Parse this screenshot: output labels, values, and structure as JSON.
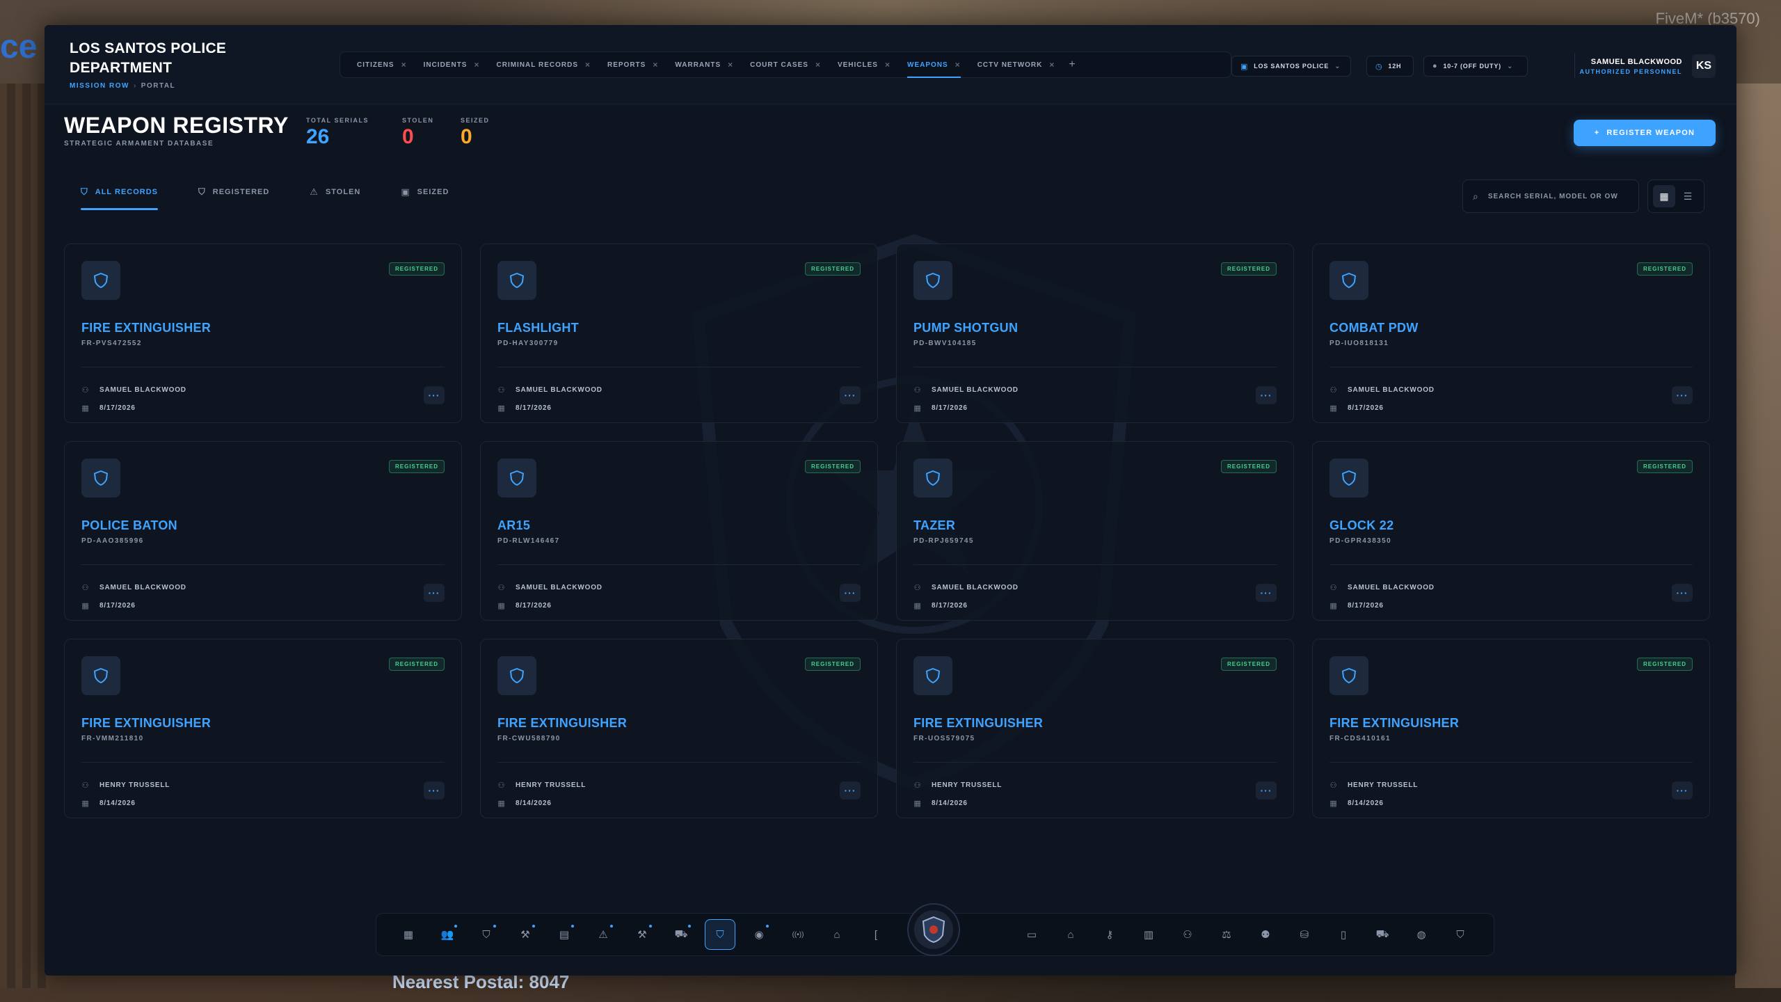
{
  "game": {
    "left_sign": "ce S",
    "fivem_label": "_FiveM* (b3570)",
    "postal_label": "Nearest Postal: 8047"
  },
  "header": {
    "dept_name": "LOS SANTOS POLICE DEPARTMENT",
    "location": "MISSION ROW",
    "portal": "PORTAL",
    "tabs": [
      {
        "label": "CITIZENS",
        "active": false
      },
      {
        "label": "INCIDENTS",
        "active": false
      },
      {
        "label": "CRIMINAL RECORDS",
        "active": false
      },
      {
        "label": "REPORTS",
        "active": false
      },
      {
        "label": "WARRANTS",
        "active": false
      },
      {
        "label": "COURT CASES",
        "active": false
      },
      {
        "label": "VEHICLES",
        "active": false
      },
      {
        "label": "WEAPONS",
        "active": true
      },
      {
        "label": "CCTV NETWORK",
        "active": false
      }
    ],
    "tab_close": "×",
    "tab_add": "+",
    "agency_select": "LOS SANTOS POLICE",
    "clock_format": "12H",
    "duty_status": "10-7 (OFF DUTY)",
    "user_name": "SAMUEL BLACKWOOD",
    "user_role": "AUTHORIZED PERSONNEL",
    "user_initials": "KS"
  },
  "page": {
    "title": "WEAPON REGISTRY",
    "subtitle": "STRATEGIC ARMAMENT DATABASE",
    "stats": [
      {
        "label": "TOTAL SERIALS",
        "value": "26",
        "color": "#3fa4ff"
      },
      {
        "label": "STOLEN",
        "value": "0",
        "color": "#ff4d4f"
      },
      {
        "label": "SEIZED",
        "value": "0",
        "color": "#ffa726"
      }
    ],
    "register_button": "REGISTER WEAPON",
    "filters": [
      {
        "label": "ALL RECORDS",
        "icon": "shield-icon",
        "active": true
      },
      {
        "label": "REGISTERED",
        "icon": "shield-check-icon",
        "active": false
      },
      {
        "label": "STOLEN",
        "icon": "warning-icon",
        "active": false
      },
      {
        "label": "SEIZED",
        "icon": "lock-icon",
        "active": false
      }
    ],
    "search_placeholder": "SEARCH SERIAL, MODEL OR OW"
  },
  "weapons": [
    {
      "name": "FIRE EXTINGUISHER",
      "serial": "FR-PVS472552",
      "owner": "SAMUEL BLACKWOOD",
      "date": "8/17/2026",
      "status": "REGISTERED"
    },
    {
      "name": "FLASHLIGHT",
      "serial": "PD-HAY300779",
      "owner": "SAMUEL BLACKWOOD",
      "date": "8/17/2026",
      "status": "REGISTERED"
    },
    {
      "name": "PUMP SHOTGUN",
      "serial": "PD-BWV104185",
      "owner": "SAMUEL BLACKWOOD",
      "date": "8/17/2026",
      "status": "REGISTERED"
    },
    {
      "name": "COMBAT PDW",
      "serial": "PD-IUO818131",
      "owner": "SAMUEL BLACKWOOD",
      "date": "8/17/2026",
      "status": "REGISTERED"
    },
    {
      "name": "POLICE BATON",
      "serial": "PD-AAO385996",
      "owner": "SAMUEL BLACKWOOD",
      "date": "8/17/2026",
      "status": "REGISTERED"
    },
    {
      "name": "AR15",
      "serial": "PD-RLW146467",
      "owner": "SAMUEL BLACKWOOD",
      "date": "8/17/2026",
      "status": "REGISTERED"
    },
    {
      "name": "TAZER",
      "serial": "PD-RPJ659745",
      "owner": "SAMUEL BLACKWOOD",
      "date": "8/17/2026",
      "status": "REGISTERED"
    },
    {
      "name": "GLOCK 22",
      "serial": "PD-GPR438350",
      "owner": "SAMUEL BLACKWOOD",
      "date": "8/17/2026",
      "status": "REGISTERED"
    },
    {
      "name": "FIRE EXTINGUISHER",
      "serial": "FR-VMM211810",
      "owner": "HENRY TRUSSELL",
      "date": "8/14/2026",
      "status": "REGISTERED"
    },
    {
      "name": "FIRE EXTINGUISHER",
      "serial": "FR-CWU588790",
      "owner": "HENRY TRUSSELL",
      "date": "8/14/2026",
      "status": "REGISTERED"
    },
    {
      "name": "FIRE EXTINGUISHER",
      "serial": "FR-UOS579075",
      "owner": "HENRY TRUSSELL",
      "date": "8/14/2026",
      "status": "REGISTERED"
    },
    {
      "name": "FIRE EXTINGUISHER",
      "serial": "FR-CDS410161",
      "owner": "HENRY TRUSSELL",
      "date": "8/14/2026",
      "status": "REGISTERED"
    }
  ],
  "more_label": "···",
  "dock": {
    "left": [
      {
        "icon": "dashboard-icon",
        "glyph": "▦",
        "dot": false
      },
      {
        "icon": "citizens-icon",
        "glyph": "👥",
        "dot": true
      },
      {
        "icon": "incidents-shield-icon",
        "glyph": "⛉",
        "dot": true
      },
      {
        "icon": "gavel-icon",
        "glyph": "⚒",
        "dot": true
      },
      {
        "icon": "reports-icon",
        "glyph": "▤",
        "dot": true
      },
      {
        "icon": "warning-icon",
        "glyph": "⚠",
        "dot": true
      },
      {
        "icon": "hammer-icon",
        "glyph": "⚒",
        "dot": true
      },
      {
        "icon": "vehicle-icon",
        "glyph": "⛟",
        "dot": true
      },
      {
        "icon": "weapons-shield-icon",
        "glyph": "⛉",
        "dot": false,
        "active": true
      },
      {
        "icon": "camera-icon",
        "glyph": "◉",
        "dot": true
      },
      {
        "icon": "radio-icon",
        "glyph": "((•))",
        "dot": false
      },
      {
        "icon": "home-icon",
        "glyph": "⌂",
        "dot": false
      },
      {
        "icon": "bracket-icon",
        "glyph": "[",
        "dot": false
      }
    ],
    "right": [
      {
        "icon": "message-icon",
        "glyph": "▭"
      },
      {
        "icon": "graduation-icon",
        "glyph": "⌂"
      },
      {
        "icon": "key-icon",
        "glyph": "⚷"
      },
      {
        "icon": "building-icon",
        "glyph": "▥"
      },
      {
        "icon": "add-user-icon",
        "glyph": "⚇"
      },
      {
        "icon": "scales-icon",
        "glyph": "⚖"
      },
      {
        "icon": "users-icon",
        "glyph": "⚉"
      },
      {
        "icon": "database-icon",
        "glyph": "⛁"
      },
      {
        "icon": "book-icon",
        "glyph": "▯"
      },
      {
        "icon": "truck-icon",
        "glyph": "⛟"
      },
      {
        "icon": "palette-icon",
        "glyph": "◍"
      },
      {
        "icon": "shield-check-icon",
        "glyph": "⛉"
      }
    ]
  }
}
